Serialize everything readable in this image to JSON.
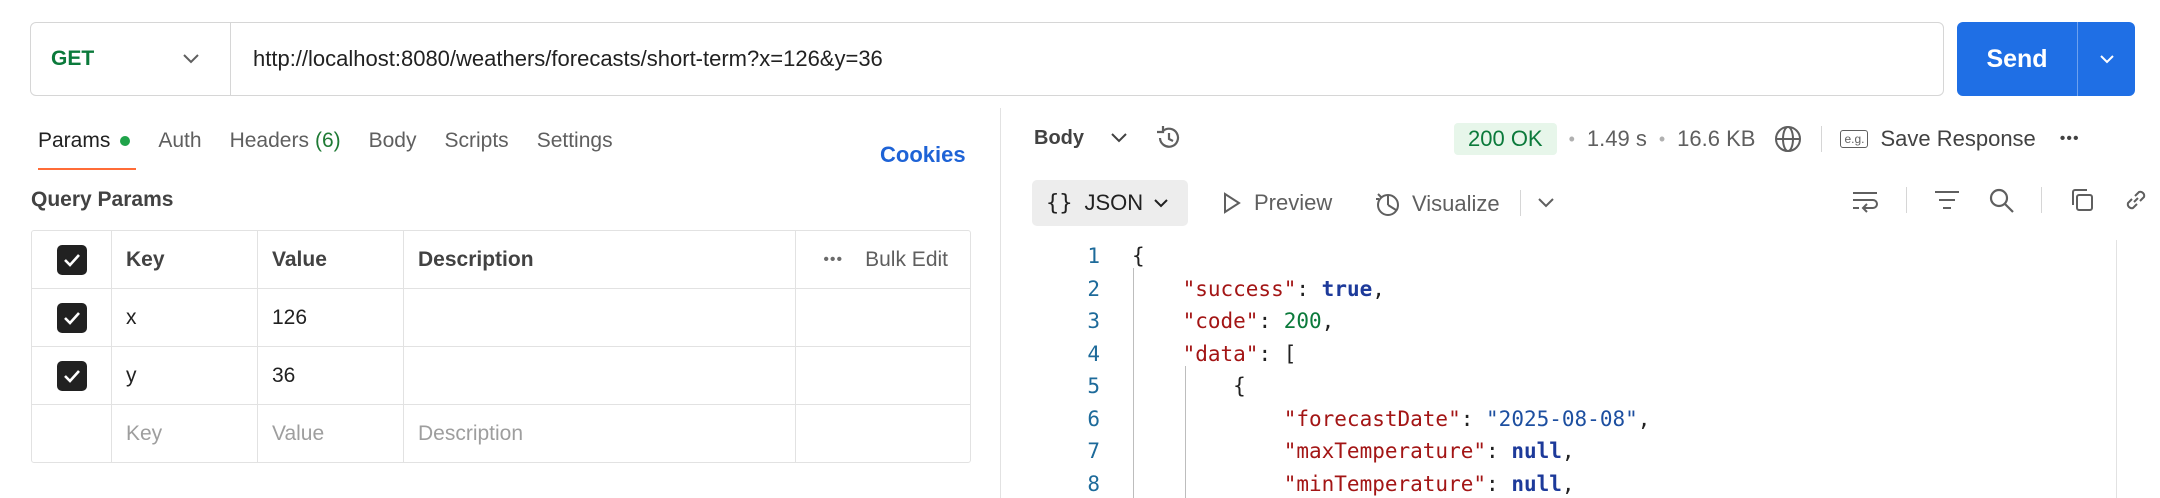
{
  "request": {
    "method": "GET",
    "url": "http://localhost:8080/weathers/forecasts/short-term?x=126&y=36",
    "send_label": "Send"
  },
  "tabs": [
    {
      "label": "Params"
    },
    {
      "label": "Auth"
    },
    {
      "label": "Headers",
      "count": "(6)"
    },
    {
      "label": "Body"
    },
    {
      "label": "Scripts"
    },
    {
      "label": "Settings"
    }
  ],
  "cookies_label": "Cookies",
  "query_params": {
    "title": "Query Params",
    "headers": {
      "key": "Key",
      "value": "Value",
      "description": "Description",
      "bulk_edit": "Bulk Edit"
    },
    "rows": [
      {
        "key": "x",
        "value": "126",
        "description": ""
      },
      {
        "key": "y",
        "value": "36",
        "description": ""
      }
    ],
    "placeholder": {
      "key": "Key",
      "value": "Value",
      "description": "Description"
    }
  },
  "response": {
    "body_label": "Body",
    "status": "200 OK",
    "time": "1.49 s",
    "size": "16.6 KB",
    "save_label": "Save Response",
    "eg_label": "e.g.",
    "format_label": "JSON",
    "format_icon": "{}",
    "preview_label": "Preview",
    "visualize_label": "Visualize"
  },
  "code_lines": [
    {
      "num": "1"
    },
    {
      "num": "2",
      "key": "\"success\"",
      "value": "true"
    },
    {
      "num": "3",
      "key": "\"code\"",
      "value": "200"
    },
    {
      "num": "4",
      "key": "\"data\"",
      "value": "["
    },
    {
      "num": "5",
      "value": "{"
    },
    {
      "num": "6",
      "key": "\"forecastDate\"",
      "value": "\"2025-08-08\""
    },
    {
      "num": "7",
      "key": "\"maxTemperature\"",
      "value": "null"
    },
    {
      "num": "8",
      "key": "\"minTemperature\"",
      "value": "null"
    }
  ],
  "code_open_brace": "{",
  "colors": {
    "send": "#1f6fe5",
    "method": "#0b7a3b",
    "cookies": "#1e63d6",
    "active_tab": "#ff6c37",
    "status_bg": "#e7f6ea"
  }
}
